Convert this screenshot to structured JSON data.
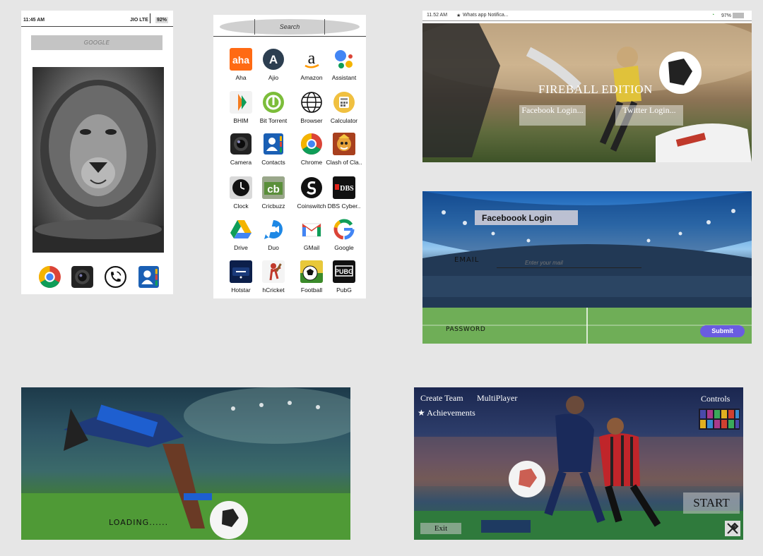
{
  "screen1": {
    "status": {
      "time": "11:45 AM",
      "carrier": "JIO LTE",
      "battery": "92%"
    },
    "search_label": "GOOGLE",
    "dock_apps": [
      "chrome-icon",
      "camera-icon",
      "phone-icon",
      "contacts-icon"
    ]
  },
  "screen2": {
    "search_label": "Search",
    "apps": [
      {
        "label": "Aha",
        "icon": "aha-icon"
      },
      {
        "label": "Ajio",
        "icon": "ajio-icon"
      },
      {
        "label": "Amazon",
        "icon": "amazon-icon"
      },
      {
        "label": "Assistant",
        "icon": "assistant-icon"
      },
      {
        "label": "BHIM",
        "icon": "bhim-icon"
      },
      {
        "label": "Bit Torrent",
        "icon": "bittorrent-icon"
      },
      {
        "label": "Browser",
        "icon": "browser-icon"
      },
      {
        "label": "Calculator",
        "icon": "calculator-icon"
      },
      {
        "label": "Camera",
        "icon": "camera-icon"
      },
      {
        "label": "Contacts",
        "icon": "contacts-icon"
      },
      {
        "label": "Chrome",
        "icon": "chrome-icon"
      },
      {
        "label": "Clash of Cla..",
        "icon": "clash-of-clans-icon"
      },
      {
        "label": "Clock",
        "icon": "clock-icon"
      },
      {
        "label": "Cricbuzz",
        "icon": "cricbuzz-icon"
      },
      {
        "label": "Coinswitch",
        "icon": "coinswitch-icon"
      },
      {
        "label": "DBS Cyber..",
        "icon": "dbs-icon"
      },
      {
        "label": "Drive",
        "icon": "drive-icon"
      },
      {
        "label": "Duo",
        "icon": "duo-icon"
      },
      {
        "label": "GMail",
        "icon": "gmail-icon"
      },
      {
        "label": "Google",
        "icon": "google-icon"
      },
      {
        "label": "Hotstar",
        "icon": "hotstar-icon"
      },
      {
        "label": "hCricket",
        "icon": "hcricket-icon"
      },
      {
        "label": "Football",
        "icon": "football-icon"
      },
      {
        "label": "PubG",
        "icon": "pubg-icon"
      }
    ],
    "icon_text": {
      "aha": "aha",
      "ajio": "A",
      "amazon": "a",
      "cricbuzz": "cb",
      "dbs": "DBS",
      "pubg": "PUBG"
    }
  },
  "screen3": {
    "status": {
      "time": "11.52 AM",
      "notification": "Whats app Notifica...",
      "battery": "97%"
    },
    "title": "FIREBALL EDITION",
    "facebook_button": "Facebook Login...",
    "twitter_button": "Twitter Login..."
  },
  "screen4": {
    "title": "Faceboook Login",
    "email_label": "EMAIL",
    "email_placeholder": "Enter your mail",
    "password_label": "PASSWORD",
    "submit_button": "Submit"
  },
  "screen5": {
    "loading_text": "LOADING......"
  },
  "screen6": {
    "menu": {
      "create_team": "Create Team",
      "multiplayer": "MultiPlayer",
      "achievements": "★ Achievements",
      "controls": "Controls"
    },
    "start_button": "START",
    "exit_button": "Exit"
  },
  "colors": {
    "submit": "#6a5ce0",
    "facebook_panel": "#c9c9d6",
    "search_bar": "#c4c4c4"
  }
}
